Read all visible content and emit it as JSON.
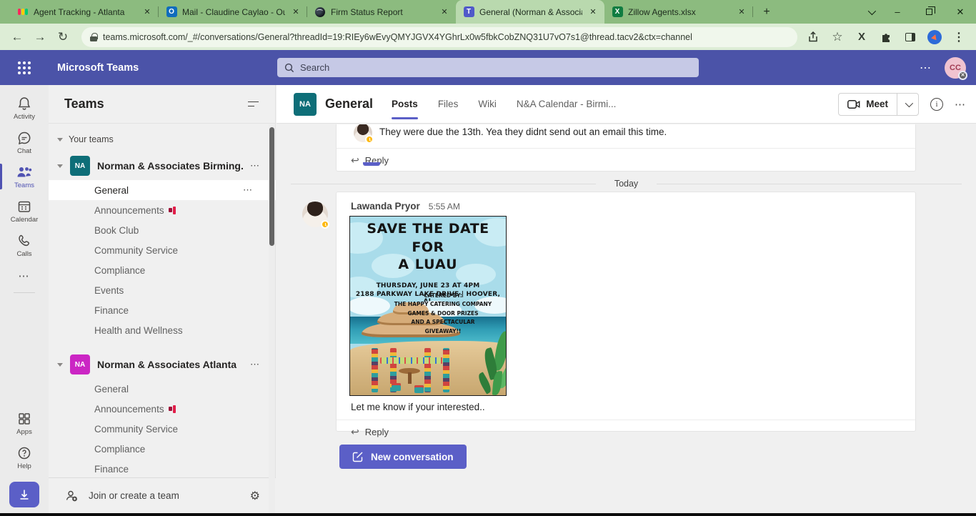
{
  "glyphs": {
    "close": "✕",
    "minimize": "–",
    "plus": "+",
    "dots3": "⋯",
    "back": "←",
    "forward": "→",
    "refresh": "↻",
    "star": "☆",
    "x_logo": "X",
    "reply_arrow": "↩",
    "gear": "⚙",
    "question": "?",
    "chevron": "⌄"
  },
  "browser": {
    "tabs": [
      {
        "title": "Agent Tracking - Atlanta"
      },
      {
        "title": "Mail - Claudine Caylao - Outl"
      },
      {
        "title": "Firm Status Report"
      },
      {
        "title": "General (Norman & Associat"
      },
      {
        "title": "Zillow Agents.xlsx"
      }
    ],
    "favicons": {
      "outlook_letter": "O",
      "teams_letter": "T",
      "excel_letter": "X"
    },
    "url": "teams.microsoft.com/_#/conversations/General?threadId=19:RIEy6wEvyQMYJGVX4YGhrLx0w5fbkCobZNQ31U7vO7s1@thread.tacv2&ctx=channel"
  },
  "app_header": {
    "title": "Microsoft Teams",
    "search_placeholder": "Search",
    "avatar_initials": "CC"
  },
  "rail": {
    "activity": "Activity",
    "chat": "Chat",
    "teams": "Teams",
    "calendar": "Calendar",
    "calls": "Calls",
    "apps": "Apps",
    "help": "Help"
  },
  "sidebar": {
    "title": "Teams",
    "your_teams_label": "Your teams",
    "teams": [
      {
        "initials": "NA",
        "color": "#0e6e78",
        "name": "Norman & Associates Birming...",
        "channels": [
          {
            "name": "General"
          },
          {
            "name": "Announcements"
          },
          {
            "name": "Book Club"
          },
          {
            "name": "Community Service"
          },
          {
            "name": "Compliance"
          },
          {
            "name": "Events"
          },
          {
            "name": "Finance"
          },
          {
            "name": "Health and Wellness"
          }
        ]
      },
      {
        "initials": "NA",
        "color": "#cb26c4",
        "name": "Norman & Associates Atlanta",
        "channels": [
          {
            "name": "General"
          },
          {
            "name": "Announcements"
          },
          {
            "name": "Community Service"
          },
          {
            "name": "Compliance"
          },
          {
            "name": "Finance"
          }
        ]
      }
    ],
    "footer_label": "Join or create a team"
  },
  "channel": {
    "initials": "NA",
    "title": "General",
    "tabs": [
      {
        "label": "Posts"
      },
      {
        "label": "Files"
      },
      {
        "label": "Wiki"
      },
      {
        "label": "N&A Calendar - Birmi..."
      }
    ],
    "meet_label": "Meet"
  },
  "conversation": {
    "thread1": {
      "message": "They were due the 13th. Yea they didnt send out an email this time.",
      "reply_label": "Reply"
    },
    "date_divider": "Today",
    "thread2": {
      "author": "Lawanda Pryor",
      "time": "5:55 AM",
      "message": "Let me know if your interested..",
      "reply_label": "Reply"
    },
    "new_conversation_label": "New conversation"
  },
  "poster": {
    "title_line1": "SAVE THE DATE FOR",
    "title_line2": "A LUAU",
    "detail_line1": "THURSDAY, JUNE 23 AT 4PM",
    "detail_line2": "2188 PARKWAY LAKE DRIVE | HOOVER, AL",
    "catered_line1": "CATERED BY:",
    "catered_line2": "THE  HAPPY CATERING COMPANY",
    "catered_line3": "GAMES & DOOR PRIZES",
    "catered_line4": "AND A SPECTACULAR",
    "catered_line5": "GIVEAWAY!!"
  },
  "colors": {
    "accent": "#5b5fc7",
    "teams_header": "#4b53a8",
    "tabbar_green": "#8cbb7f",
    "active_tab_green": "#b9d9ae",
    "teal_team": "#0e6e78",
    "magenta_team": "#cb26c4"
  }
}
